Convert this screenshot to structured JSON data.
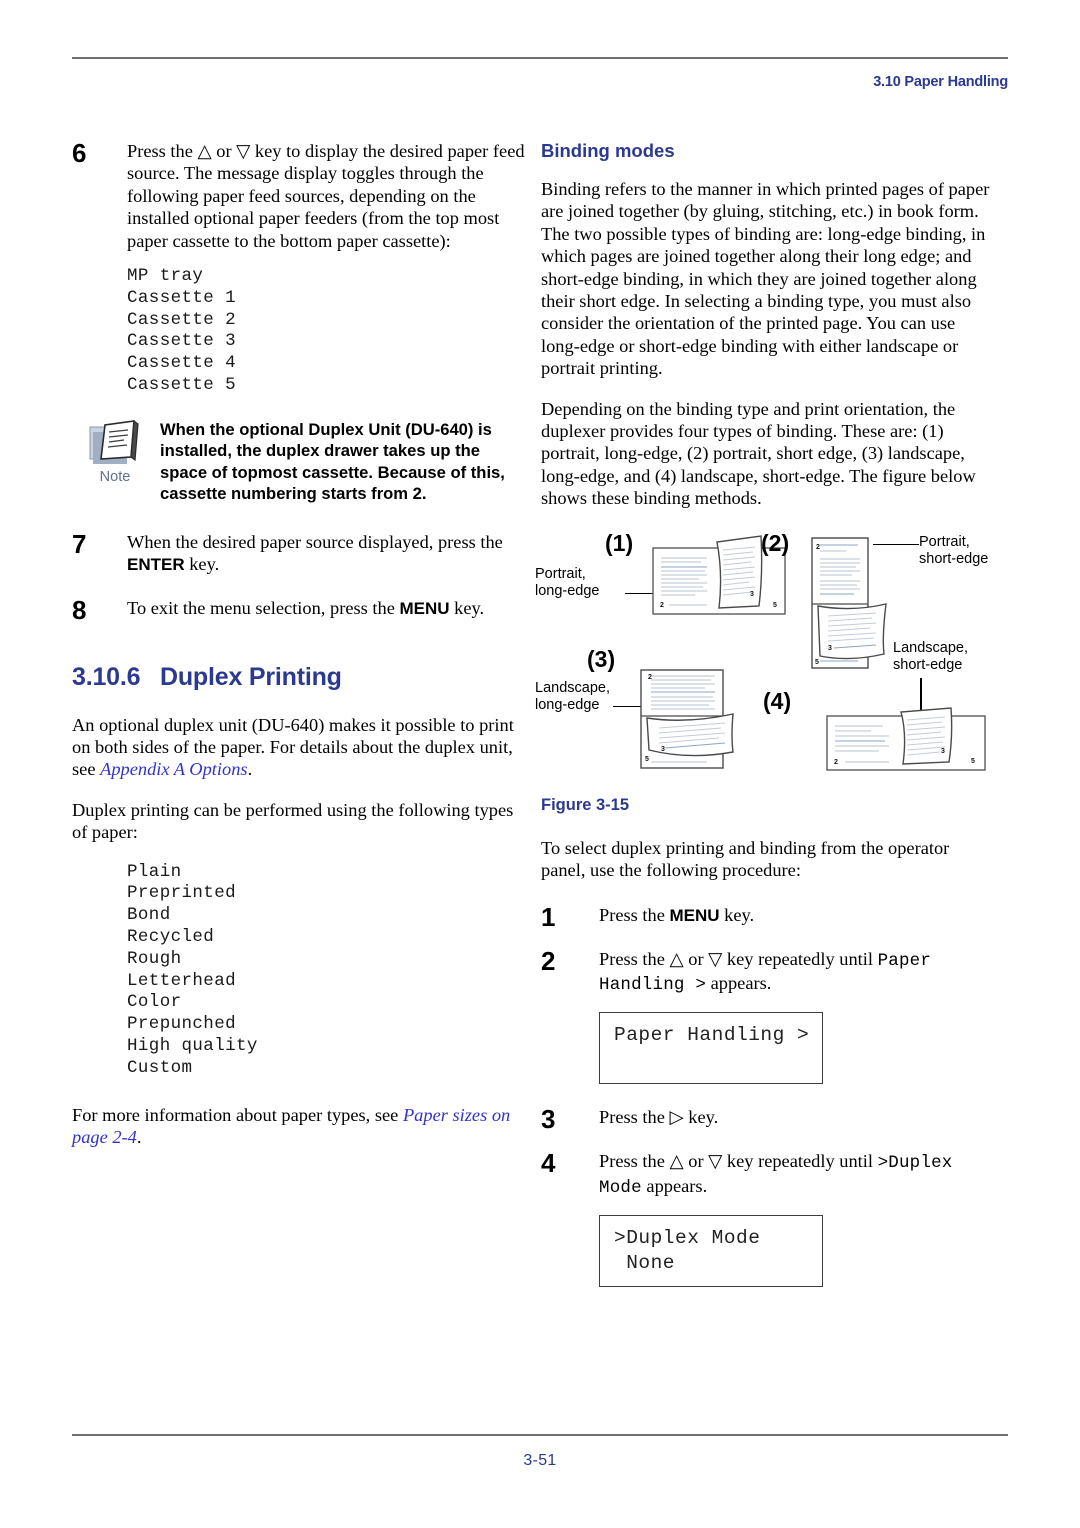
{
  "header": {
    "section_ref": "3.10 Paper Handling"
  },
  "footer": {
    "page_number": "3-51"
  },
  "colors": {
    "accent_blue": "#2b3990",
    "xref_blue": "#3333cc",
    "note_label": "#5b7390",
    "rule_gray": "#6f6f6f"
  },
  "left_column": {
    "step6": {
      "number": "6",
      "text_a": "Press the ",
      "sym_up": "△",
      "text_b": " or ",
      "sym_down": "▽",
      "text_c": " key to display the desired paper feed source. The message display toggles through the following paper feed sources, depending on the installed optional paper feeders (from the top most paper cassette to the bottom paper cassette):",
      "sources": "MP tray\nCassette 1\nCassette 2\nCassette 3\nCassette 4\nCassette 5"
    },
    "note": {
      "icon": "note-document-icon",
      "label": "Note",
      "text": "When the optional Duplex Unit (DU-640) is installed, the duplex drawer takes up the space of topmost cassette. Because of this, cassette numbering starts from 2."
    },
    "step7": {
      "number": "7",
      "text_a": "When the desired paper source displayed, press the ",
      "key": "ENTER",
      "text_b": " key."
    },
    "step8": {
      "number": "8",
      "text_a": "To exit the menu selection, press the ",
      "key": "MENU",
      "text_b": " key."
    },
    "heading": {
      "number": "3.10.6",
      "title": "Duplex Printing"
    },
    "para1": {
      "text_a": "An optional duplex unit (DU-640) makes it possible to print on both sides of the paper. For details about the duplex unit, see ",
      "xref": "Appendix A Options",
      "text_b": "."
    },
    "para2": "Duplex printing can be performed using the following types of paper:",
    "paper_types": "Plain\nPreprinted\nBond\nRecycled\nRough\nLetterhead\nColor\nPrepunched\nHigh quality\nCustom",
    "para3": {
      "text_a": "For more information about paper types, see ",
      "xref": "Paper sizes on page 2-4",
      "text_b": "."
    }
  },
  "right_column": {
    "subheading": "Binding modes",
    "para1": "Binding refers to the manner in which printed pages of paper are joined together (by gluing, stitching, etc.) in book form. The two possible types of binding are: long-edge binding, in which pages are joined together along their long edge; and short-edge binding, in which they are joined together along their short edge. In selecting a binding type, you must also consider the orientation of the printed page. You can use long-edge or short-edge binding with either landscape or portrait printing.",
    "para2": "Depending on the binding type and print orientation, the duplexer provides four types of binding. These are: (1) portrait, long-edge, (2) portrait, short edge, (3) landscape, long-edge, and (4) landscape, short-edge. The figure below shows these binding methods.",
    "figure": {
      "caption": "Figure 3-15",
      "items": [
        {
          "num": "(1)",
          "label_line1": "Portrait,",
          "label_line2": "long-edge",
          "page_marks": [
            "2",
            "3",
            "5"
          ]
        },
        {
          "num": "(2)",
          "label_line1": "Portrait,",
          "label_line2": "short-edge",
          "page_marks": [
            "2",
            "3",
            "5"
          ]
        },
        {
          "num": "(3)",
          "label_line1": "Landscape,",
          "label_line2": "long-edge",
          "page_marks": [
            "2",
            "3",
            "5"
          ]
        },
        {
          "num": "(4)",
          "label_line1": "Landscape,",
          "label_line2": "short-edge",
          "page_marks": [
            "2",
            "3",
            "5"
          ]
        }
      ]
    },
    "para3": "To select duplex printing and binding from the operator panel, use the following procedure:",
    "step1": {
      "number": "1",
      "text_a": "Press the ",
      "key": "MENU",
      "text_b": " key."
    },
    "step2": {
      "number": "2",
      "text_a": "Press the ",
      "sym_up": "△",
      "text_b": " or ",
      "sym_down": "▽",
      "text_c": " key repeatedly until ",
      "mono": "Paper Handling >",
      "text_d": " appears."
    },
    "lcd1": "Paper Handling >",
    "step3": {
      "number": "3",
      "text_a": "Press the ",
      "sym_right": "▷",
      "text_b": " key."
    },
    "step4": {
      "number": "4",
      "text_a": "Press the ",
      "sym_up": "△",
      "text_b": " or ",
      "sym_down": "▽",
      "text_c": " key repeatedly until ",
      "mono": ">Duplex Mode",
      "text_d": " appears."
    },
    "lcd2": ">Duplex Mode\n None"
  }
}
